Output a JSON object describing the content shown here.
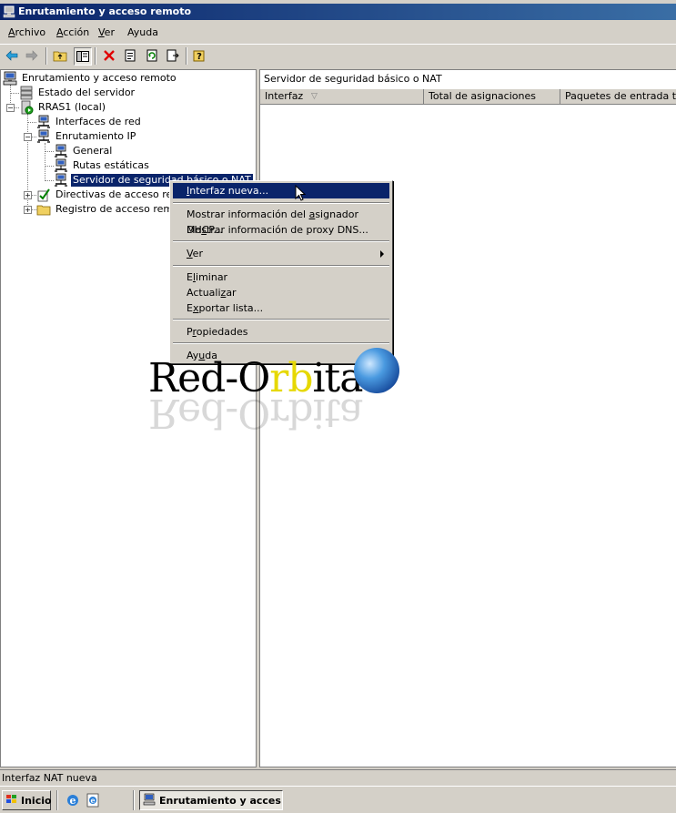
{
  "window": {
    "title": "Enrutamiento y acceso remoto"
  },
  "menu": [
    {
      "label": "Archivo",
      "accel": "A",
      "rest": "rchivo"
    },
    {
      "label": "Acción",
      "accel": "A",
      "rest": "cción"
    },
    {
      "label": "Ver",
      "accel": "V",
      "rest": "er"
    },
    {
      "label": "Ayuda",
      "accel": "",
      "rest": "Ayuda"
    }
  ],
  "toolbar": {
    "icons": [
      "back-icon",
      "forward-icon",
      "up-folder-icon",
      "show-hide-tree-icon",
      "delete-icon",
      "properties-icon",
      "refresh-icon",
      "export-list-icon",
      "help-icon"
    ]
  },
  "tree": {
    "root": "Enrutamiento y acceso remoto",
    "server_status": "Estado del servidor",
    "server": "RRAS1 (local)",
    "network_interfaces": "Interfaces de red",
    "ip_routing": "Enrutamiento IP",
    "general": "General",
    "static_routes": "Rutas estáticas",
    "nat": "Servidor de seguridad básico o NAT",
    "remote_access_policies": "Directivas de acceso remoto",
    "remote_access_logging": "Registro de acceso remoto"
  },
  "list": {
    "title": "Servidor de seguridad básico o NAT",
    "columns": [
      "Interfaz",
      "Total de asignaciones",
      "Paquetes de entrada traducidos"
    ]
  },
  "context_menu": {
    "new_interface": {
      "pre": "",
      "accel": "I",
      "post": "nterfaz nueva..."
    },
    "dhcp": {
      "pre": "Mostrar información del ",
      "accel": "a",
      "post": "signador DHCP..."
    },
    "dns": {
      "pre": "Mo",
      "accel": "s",
      "post": "trar información de proxy DNS..."
    },
    "view": {
      "pre": "",
      "accel": "V",
      "post": "er"
    },
    "delete": {
      "pre": "E",
      "accel": "l",
      "post": "iminar"
    },
    "refresh": {
      "pre": "Actuali",
      "accel": "z",
      "post": "ar"
    },
    "export": {
      "pre": "E",
      "accel": "x",
      "post": "portar lista..."
    },
    "properties": {
      "pre": "P",
      "accel": "r",
      "post": "opiedades"
    },
    "help": {
      "pre": "Ay",
      "accel": "u",
      "post": "da"
    }
  },
  "watermark": {
    "part1": "Red-O",
    "part2": "rb",
    "part3": "ita"
  },
  "status": {
    "text": "Interfaz NAT nueva"
  },
  "taskbar": {
    "start": "Inicio",
    "app": "Enrutamiento y acces..."
  }
}
